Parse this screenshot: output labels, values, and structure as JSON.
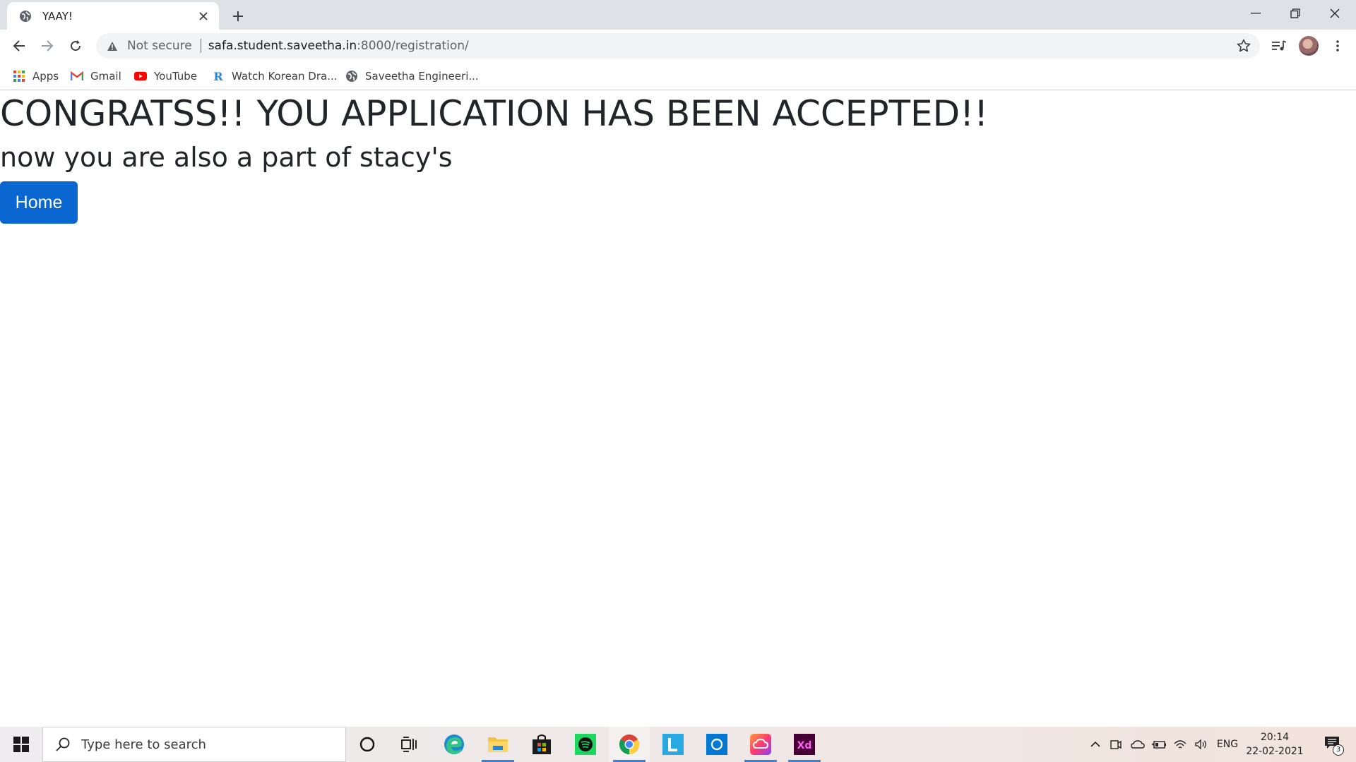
{
  "browser": {
    "tab_title": "YAAY!",
    "security_label": "Not secure",
    "url_host": "safa.student.saveetha.in",
    "url_path": ":8000/registration/"
  },
  "bookmarks": [
    {
      "label": "Apps",
      "icon": "apps-grid-icon"
    },
    {
      "label": "Gmail",
      "icon": "gmail-icon"
    },
    {
      "label": "YouTube",
      "icon": "youtube-icon"
    },
    {
      "label": "Watch Korean Dra...",
      "icon": "rakuten-icon"
    },
    {
      "label": "Saveetha Engineeri...",
      "icon": "globe-icon"
    }
  ],
  "page": {
    "heading": "CONGRATSS!! YOU APPLICATION HAS BEEN ACCEPTED!!",
    "subheading": "now you are also a part of stacy's",
    "home_button": "Home"
  },
  "taskbar": {
    "search_placeholder": "Type here to search",
    "language": "ENG",
    "time": "20:14",
    "date": "22-02-2021",
    "notification_count": "3",
    "apps": [
      "cortana",
      "task-view",
      "edge",
      "file-explorer",
      "microsoft-store",
      "spotify",
      "chrome",
      "lens",
      "cortana-app",
      "creative-cloud",
      "adobe-xd"
    ]
  },
  "colors": {
    "primary_button": "#0a66d0",
    "heading_text": "#212529",
    "tab_strip": "#dee1e6"
  }
}
